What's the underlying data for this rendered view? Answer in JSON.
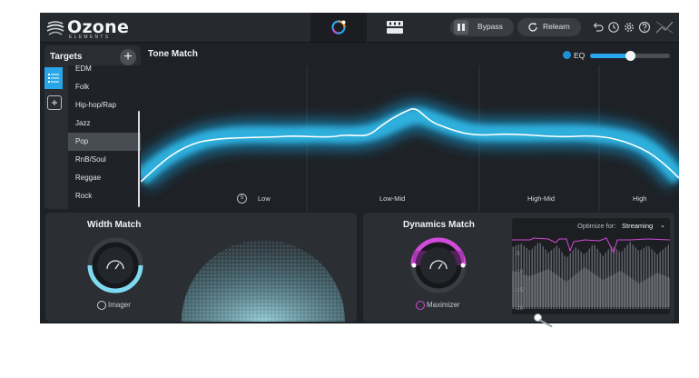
{
  "app": {
    "name": "Ozone",
    "edition": "ELEMENTS",
    "bypass_label": "Bypass",
    "relearn_label": "Relearn"
  },
  "icons": {
    "logo": "ozone-logo-icon",
    "assistant_tab": "assistant-ring-icon",
    "modules_tab": "modules-grid-icon",
    "bypass": "bypass-switch-icon",
    "relearn": "refresh-icon",
    "undo": "undo-icon",
    "history": "history-icon",
    "settings": "gear-icon",
    "help": "help-icon",
    "signal": "signal-path-icon"
  },
  "targets": {
    "title": "Targets",
    "items": [
      "EDM",
      "Folk",
      "Hip-hop/Rap",
      "Jazz",
      "Pop",
      "RnB/Soul",
      "Reggae",
      "Rock"
    ],
    "selected": "Pop"
  },
  "tone_match": {
    "title": "Tone Match",
    "eq_label": "EQ",
    "eq_amount": 0.5,
    "bands": [
      "Low",
      "Low-Mid",
      "High-Mid",
      "High"
    ]
  },
  "width_match": {
    "title": "Width Match",
    "module_label": "Imager"
  },
  "dynamics_match": {
    "title": "Dynamics Match",
    "module_label": "Maximizer",
    "optimize_label": "Optimize for:",
    "optimize_value": "Streaming",
    "db_ticks": [
      "-5",
      "-10",
      "-15",
      "-20"
    ]
  },
  "colors": {
    "accent_blue": "#2aa6ee",
    "tone_glow": "#1fb8f0",
    "dynamics_magenta": "#d04bd8",
    "width_cyan": "#7fd9f0"
  }
}
